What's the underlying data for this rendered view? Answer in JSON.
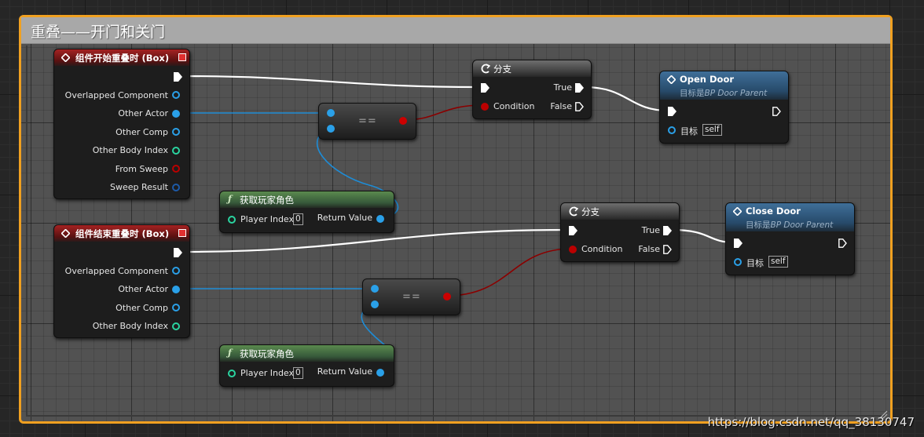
{
  "comment": {
    "title": "重叠——开门和关门"
  },
  "colors": {
    "exec": "#ffffff",
    "object": "#2aa0e8",
    "bool": "#b00000",
    "comment_border": "#f0a020"
  },
  "nodes": {
    "begin_overlap": {
      "title": "组件开始重叠时 (Box)",
      "pins": [
        "Overlapped Component",
        "Other Actor",
        "Other Comp",
        "Other Body Index",
        "From Sweep",
        "Sweep Result"
      ]
    },
    "end_overlap": {
      "title": "组件结束重叠时 (Box)",
      "pins": [
        "Overlapped Component",
        "Other Actor",
        "Other Comp",
        "Other Body Index"
      ]
    },
    "branch1": {
      "title": "分支",
      "condition": "Condition",
      "true": "True",
      "false": "False"
    },
    "branch2": {
      "title": "分支",
      "condition": "Condition",
      "true": "True",
      "false": "False"
    },
    "equal1": {
      "symbol": "=="
    },
    "equal2": {
      "symbol": "=="
    },
    "get_player1": {
      "title": "获取玩家角色",
      "player_index": "Player Index",
      "index_value": "0",
      "return_value": "Return Value"
    },
    "get_player2": {
      "title": "获取玩家角色",
      "player_index": "Player Index",
      "index_value": "0",
      "return_value": "Return Value"
    },
    "open_door": {
      "title": "Open Door",
      "subtitle_prefix": "目标是",
      "subtitle_class": "BP Door Parent",
      "target": "目标",
      "target_value": "self"
    },
    "close_door": {
      "title": "Close Door",
      "subtitle_prefix": "目标是",
      "subtitle_class": "BP Door Parent",
      "target": "目标",
      "target_value": "self"
    }
  },
  "watermark": "https://blog.csdn.net/qq_38130747"
}
